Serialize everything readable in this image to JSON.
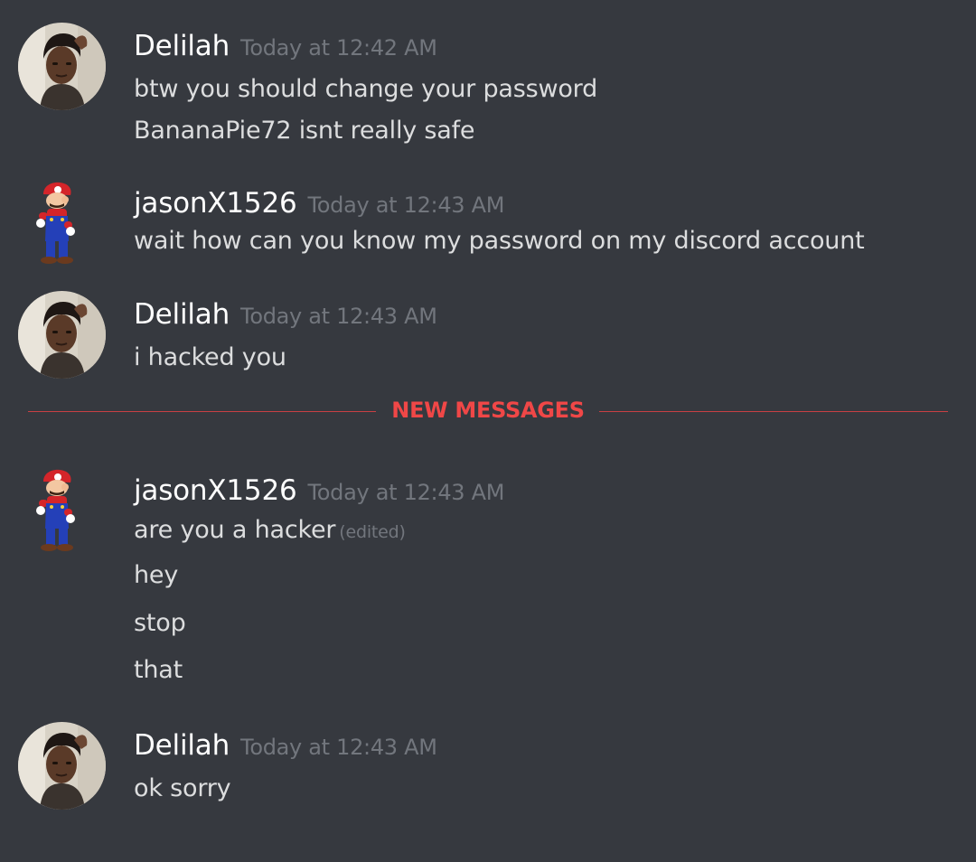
{
  "colors": {
    "background": "#36393f",
    "username": "#ffffff",
    "message_text": "#dcddde",
    "timestamp": "#72767d",
    "new_messages_accent": "#f04747"
  },
  "divider": {
    "label": "NEW MESSAGES"
  },
  "messages": [
    {
      "author": "Delilah",
      "avatar": "photo-avatar",
      "timestamp": "Today at 12:42 AM",
      "lines": [
        "btw you should change your password",
        "BananaPie72 isnt really safe"
      ]
    },
    {
      "author": "jasonX1526",
      "avatar": "mario-avatar",
      "timestamp": "Today at 12:43 AM",
      "lines": [
        "wait how can you know my password on my discord account"
      ]
    },
    {
      "author": "Delilah",
      "avatar": "photo-avatar",
      "timestamp": "Today at 12:43 AM",
      "lines": [
        "i hacked you"
      ]
    },
    {
      "author": "jasonX1526",
      "avatar": "mario-avatar",
      "timestamp": "Today at 12:43 AM",
      "lines": [
        "are you a hacker",
        "hey",
        "stop",
        "that"
      ],
      "edited_label": "(edited)"
    },
    {
      "author": "Delilah",
      "avatar": "photo-avatar",
      "timestamp": "Today at 12:43 AM",
      "lines": [
        "ok sorry"
      ]
    }
  ]
}
